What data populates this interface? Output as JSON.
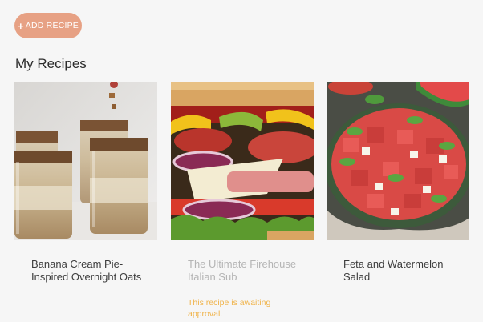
{
  "header": {
    "add_button": {
      "icon": "plus-icon",
      "label": "ADD RECIPE"
    },
    "page_title": "My Recipes"
  },
  "colors": {
    "accent": "#e7a184",
    "pending_text": "#b5b5b5",
    "status_text": "#f0b44c",
    "background": "#f6f6f6"
  },
  "recipes": [
    {
      "name": "Banana Cream Pie-Inspired Overnight Oats",
      "image": "overnight-oats-jars-photo",
      "status": ""
    },
    {
      "name": "The Ultimate Firehouse Italian Sub",
      "image": "italian-sub-sandwich-photo",
      "status": "This recipe is awaiting approval."
    },
    {
      "name": "Feta and Watermelon Salad",
      "image": "watermelon-feta-salad-photo",
      "status": ""
    }
  ]
}
